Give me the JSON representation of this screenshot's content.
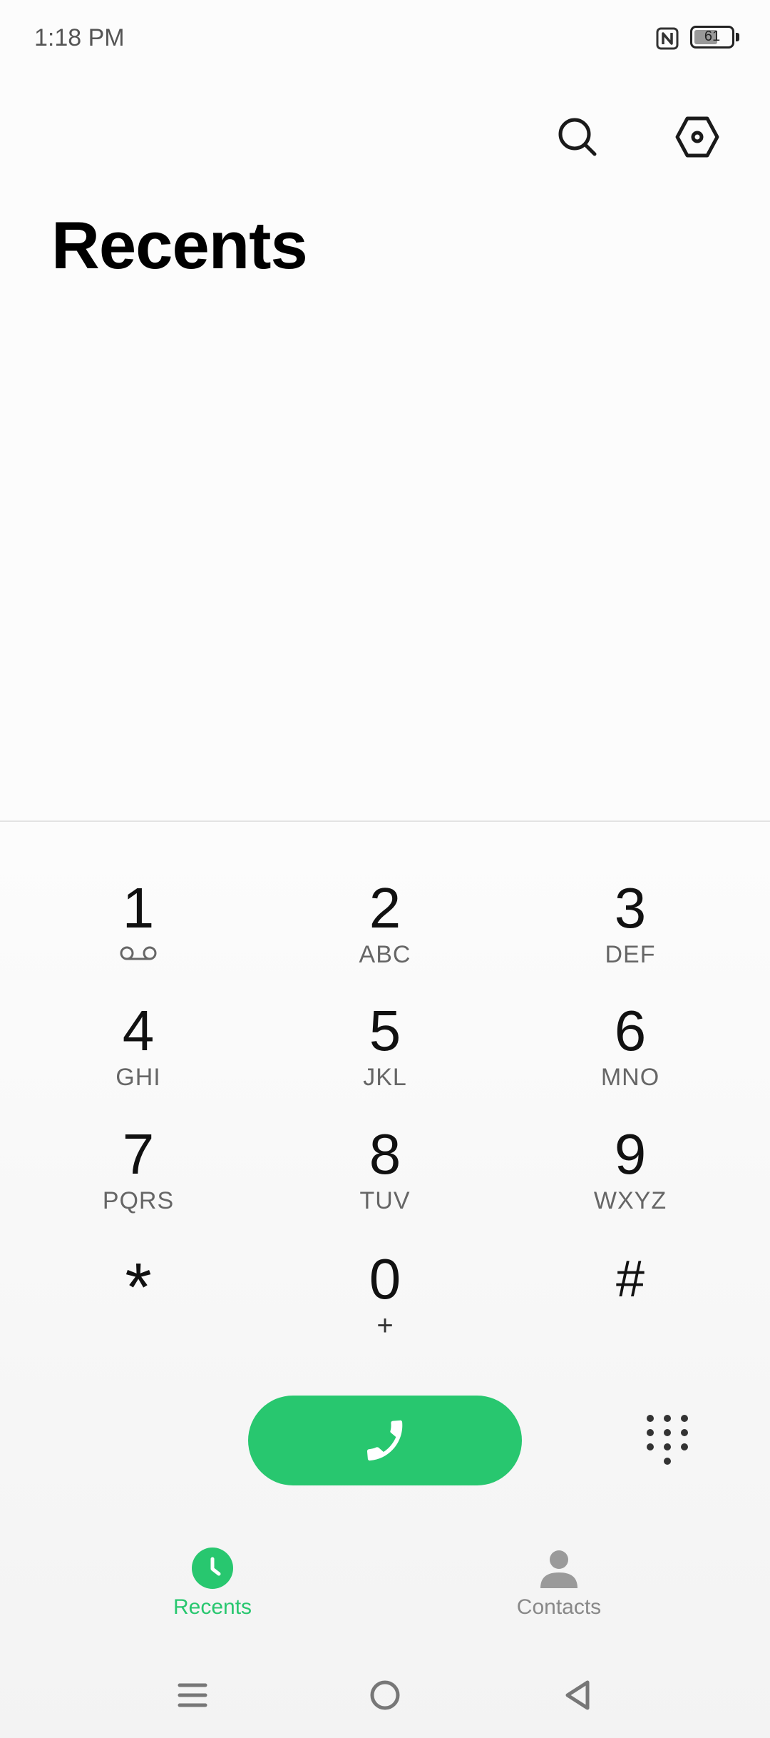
{
  "status_bar": {
    "time": "1:18 PM",
    "battery_level": "61",
    "icons": [
      "nfc-icon",
      "battery-icon"
    ]
  },
  "header": {
    "title": "Recents",
    "icons": [
      "search-icon",
      "settings-icon"
    ]
  },
  "dialpad": {
    "keys": [
      {
        "digit": "1",
        "sub": "",
        "icon": "voicemail-icon"
      },
      {
        "digit": "2",
        "sub": "ABC"
      },
      {
        "digit": "3",
        "sub": "DEF"
      },
      {
        "digit": "4",
        "sub": "GHI"
      },
      {
        "digit": "5",
        "sub": "JKL"
      },
      {
        "digit": "6",
        "sub": "MNO"
      },
      {
        "digit": "7",
        "sub": "PQRS"
      },
      {
        "digit": "8",
        "sub": "TUV"
      },
      {
        "digit": "9",
        "sub": "WXYZ"
      },
      {
        "digit": "*",
        "sub": ""
      },
      {
        "digit": "0",
        "sub": "+"
      },
      {
        "digit": "#",
        "sub": ""
      }
    ],
    "call_icon": "phone-icon",
    "toggle_icon": "dialpad-icon"
  },
  "bottom_nav": {
    "items": [
      {
        "label": "Recents",
        "icon": "clock-icon",
        "active": true
      },
      {
        "label": "Contacts",
        "icon": "person-icon",
        "active": false
      }
    ],
    "active_color": "#28c76f",
    "inactive_color": "#888888"
  },
  "system_nav": {
    "icons": [
      "menu-icon",
      "home-icon",
      "back-icon"
    ]
  }
}
